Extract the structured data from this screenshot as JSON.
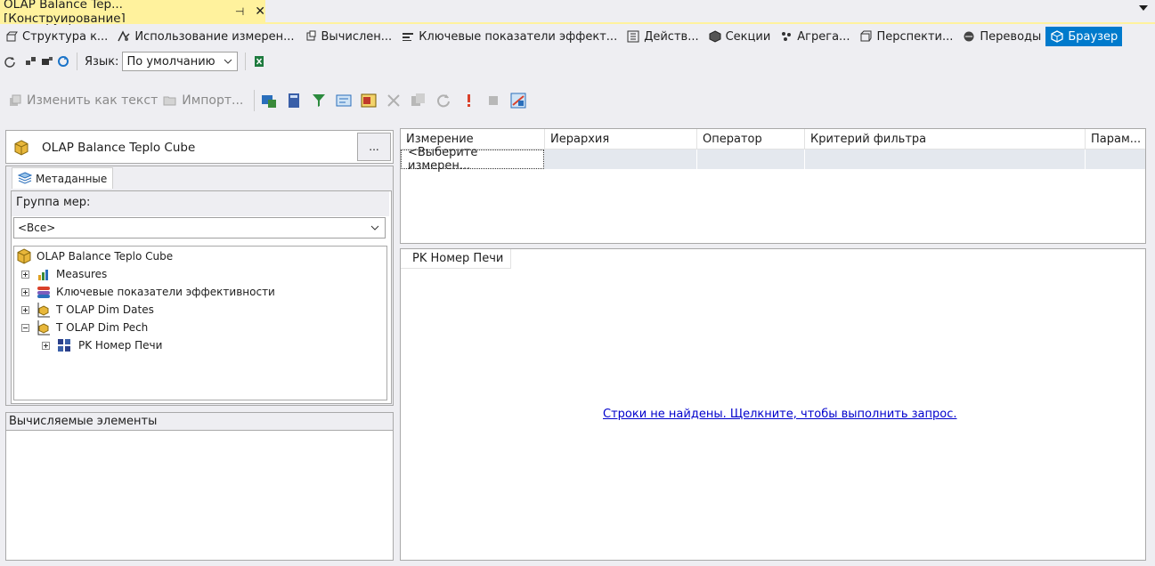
{
  "document_tab": {
    "title": "OLAP Balance Tep...[Конструирование]",
    "pin_glyph": "⊣",
    "close_glyph": "✕"
  },
  "designer_tabs": [
    {
      "label": "Структура к...",
      "icon": "cube-structure-icon"
    },
    {
      "label": "Использование измерен...",
      "icon": "dimension-usage-icon"
    },
    {
      "label": "Вычислен...",
      "icon": "calculations-icon"
    },
    {
      "label": "Ключевые показатели эффект...",
      "icon": "kpi-icon"
    },
    {
      "label": "Действ...",
      "icon": "actions-icon"
    },
    {
      "label": "Секции",
      "icon": "partitions-icon"
    },
    {
      "label": "Агрега...",
      "icon": "aggregations-icon"
    },
    {
      "label": "Перспекти...",
      "icon": "perspectives-icon"
    },
    {
      "label": "Переводы",
      "icon": "translations-icon"
    },
    {
      "label": "Браузер",
      "icon": "browser-icon",
      "active": true
    }
  ],
  "toolbar2": {
    "language_label": "Язык:",
    "language_value": "По умолчанию"
  },
  "toolbar3": {
    "edit_as_text": "Изменить как текст",
    "import": "Импорт..."
  },
  "cube_selector": {
    "name": "OLAP Balance Teplo Cube",
    "browse_button": "..."
  },
  "metadata_tab": {
    "label": "Метаданные"
  },
  "measure_group": {
    "label": "Группа мер:",
    "value": "<Все>"
  },
  "tree": {
    "root": "OLAP Balance Teplo Cube",
    "items": [
      {
        "label": "Measures",
        "icon": "measures-icon",
        "expander": "plus"
      },
      {
        "label": "Ключевые показатели эффективности",
        "icon": "kpi-icon",
        "expander": "plus"
      },
      {
        "label": "T OLAP Dim Dates",
        "icon": "dimension-icon",
        "expander": "plus"
      },
      {
        "label": "T OLAP Dim Pech",
        "icon": "dimension-icon",
        "expander": "minus"
      },
      {
        "label": "PK Номер Печи",
        "icon": "hierarchy-icon",
        "expander": "plus",
        "child": true
      }
    ]
  },
  "calculated_members": {
    "label": "Вычисляемые элементы"
  },
  "filter_grid": {
    "columns": [
      "Измерение",
      "Иерархия",
      "Оператор",
      "Критерий фильтра",
      "Парам..."
    ],
    "first_cell": "<Выберите измерен..."
  },
  "results": {
    "column_header": "PK Номер Печи",
    "empty_message": "Строки не найдены. Щелкните, чтобы выполнить запрос."
  },
  "colors": {
    "tab_accent": "#fff29d",
    "active_blue": "#007acc",
    "link": "#0000cc"
  }
}
